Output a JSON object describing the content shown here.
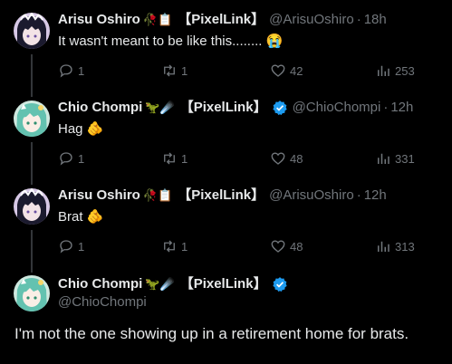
{
  "tweets": [
    {
      "name": "Arisu Oshiro",
      "emojis": "🥀📋",
      "tag": "【PixelLink】",
      "handle": "@ArisuOshiro",
      "sep": "·",
      "time": "18h",
      "text": "It wasn't meant to be like this........ 😭",
      "replies": "1",
      "reposts": "1",
      "likes": "42",
      "views": "253"
    },
    {
      "name": "Chio Chompi",
      "emojis": "🦖☄️",
      "tag": "【PixelLink】",
      "handle": "@ChioChompi",
      "sep": "·",
      "time": "12h",
      "text": "Hag 🫵",
      "replies": "1",
      "reposts": "1",
      "likes": "48",
      "views": "331"
    },
    {
      "name": "Arisu Oshiro",
      "emojis": "🥀📋",
      "tag": "【PixelLink】",
      "handle": "@ArisuOshiro",
      "sep": "·",
      "time": "12h",
      "text": "Brat 🫵",
      "replies": "1",
      "reposts": "1",
      "likes": "48",
      "views": "313"
    }
  ],
  "main": {
    "name": "Chio Chompi",
    "emojis": "🦖☄️",
    "tag": "【PixelLink】",
    "handle": "@ChioChompi",
    "text": "I'm not the one showing up in a retirement home for brats."
  },
  "colors": {
    "background": "#000000",
    "text": "#e7e9ea",
    "muted": "#71767b",
    "verified": "#1d9bf0"
  }
}
